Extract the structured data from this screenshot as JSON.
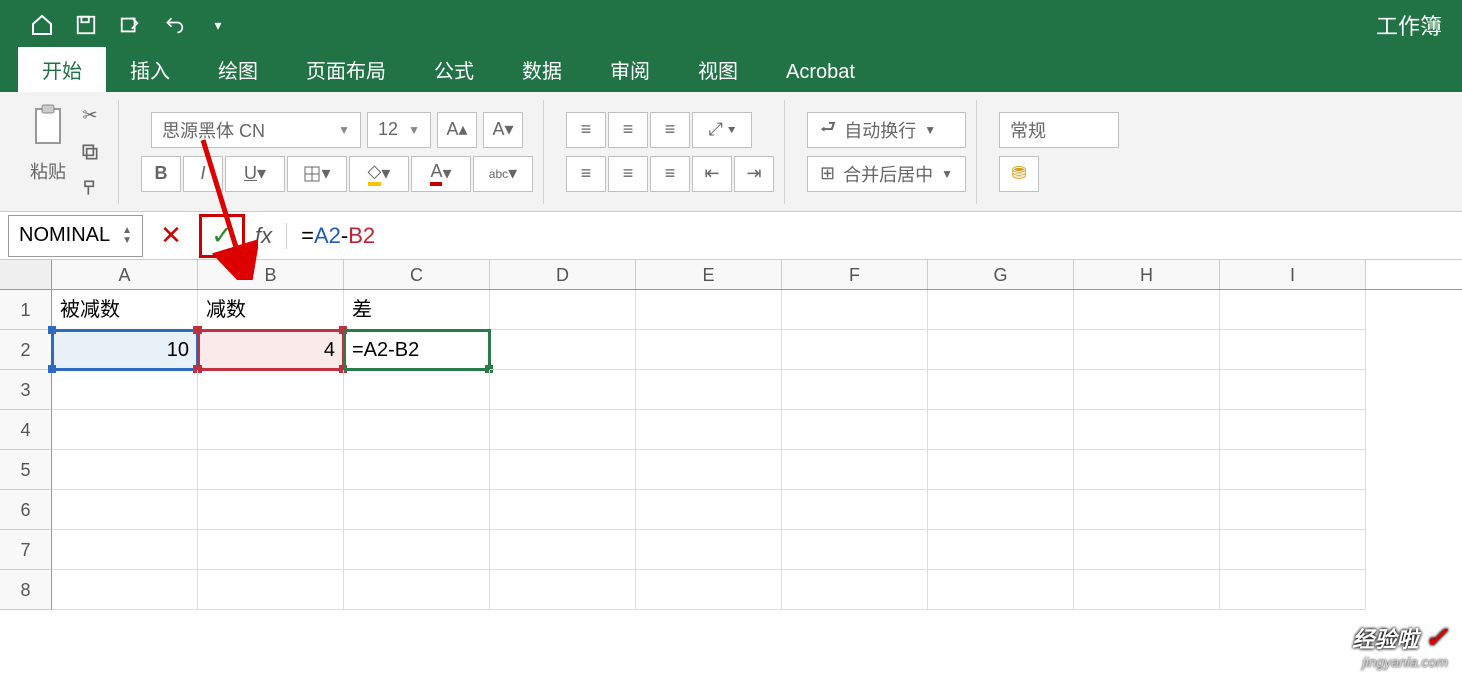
{
  "titlebar": {
    "title": "工作簿"
  },
  "tabs": [
    "开始",
    "插入",
    "绘图",
    "页面布局",
    "公式",
    "数据",
    "审阅",
    "视图",
    "Acrobat"
  ],
  "ribbon": {
    "paste_label": "粘贴",
    "font_name": "思源黑体 CN",
    "font_size": "12",
    "wrap_text": "自动换行",
    "merge_center": "合并后居中",
    "number_format": "常规"
  },
  "formula_bar": {
    "name_box": "NOMINAL",
    "fx": "fx",
    "prefix": "=",
    "ref_a": "A2",
    "op": "-",
    "ref_b": "B2"
  },
  "columns": [
    "A",
    "B",
    "C",
    "D",
    "E",
    "F",
    "G",
    "H",
    "I"
  ],
  "rows": [
    "1",
    "2",
    "3",
    "4",
    "5",
    "6",
    "7",
    "8"
  ],
  "cells": {
    "A1": "被减数",
    "B1": "减数",
    "C1": "差",
    "A2": "10",
    "B2": "4",
    "C2": "=A2-B2"
  },
  "watermark": {
    "line1": "经验啦",
    "line2": "jingyanla.com"
  }
}
